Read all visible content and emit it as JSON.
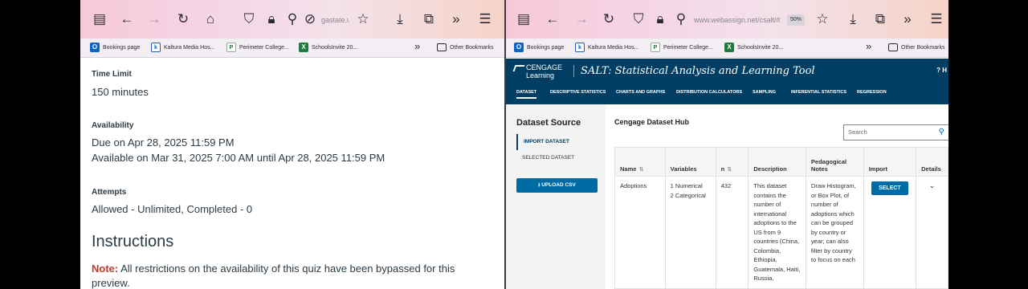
{
  "left_browser": {
    "url": "gastate.w",
    "bookmarks": [
      "Bookings page",
      "Kaltura Media Hos...",
      "Perimeter College...",
      "SchoolsInvite 20..."
    ],
    "other_bookmarks": "Other Bookmarks"
  },
  "quiz": {
    "time_limit_label": "Time Limit",
    "time_limit_value": "150 minutes",
    "availability_label": "Availability",
    "due": "Due on Apr 28, 2025 11:59 PM",
    "available": "Available on Mar 31, 2025 7:00 AM until Apr 28, 2025 11:59 PM",
    "attempts_label": "Attempts",
    "attempts_value": "Allowed - Unlimited, Completed - 0",
    "instructions_heading": "Instructions",
    "note_label": "Note:",
    "note_text": " All restrictions on the availability of this quiz have been bypassed for this preview."
  },
  "right_browser": {
    "url": "www.webassign.net/csalt/#/",
    "zoom": "50%",
    "bookmarks": [
      "Bookings page",
      "Kaltura Media Hos...",
      "Perimeter College...",
      "SchoolsInvite 20..."
    ],
    "other_bookmarks": "Other Bookmarks"
  },
  "salt": {
    "brand_top": "CENGAGE",
    "brand_bottom": "Learning",
    "title": "SALT: Statistical Analysis and Learning Tool",
    "help": "? H",
    "nav": [
      "DATASET",
      "DESCRIPTIVE STATISTICS",
      "CHARTS AND GRAPHS",
      "DISTRIBUTION CALCULATORS",
      "SAMPLING",
      "INFERENTIAL STATISTICS",
      "REGRESSION"
    ],
    "sidebar_title": "Dataset Source",
    "import_dataset": "IMPORT DATASET",
    "selected_dataset": "SELECTED DATASET",
    "upload_csv": "UPLOAD CSV",
    "hub_title": "Cengage Dataset Hub",
    "search_placeholder": "Search",
    "columns": [
      "Name",
      "Variables",
      "n",
      "Description",
      "Pedagogical Notes",
      "Import",
      "Details"
    ],
    "row": {
      "name": "Adoptions",
      "variables_1": "1 Numerical",
      "variables_2": "2 Categorical",
      "n": "432",
      "description": "This dataset contains the number of international adoptions to the US from 9 countries (China, Colombia, Ethiopia, Guatemala, Haiti, Russia,",
      "notes": "Draw Histogram, or Box Plot, of number of adoptions which can be grouped by country or year; can also filter by country to focus on each",
      "select": "SELECT"
    }
  }
}
